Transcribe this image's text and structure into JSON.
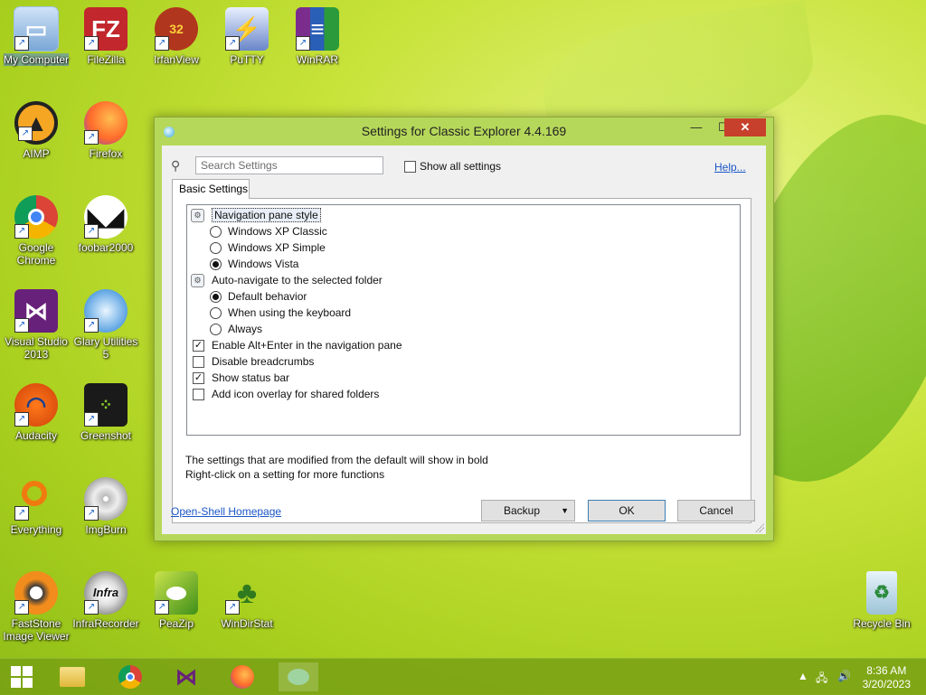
{
  "desktop": {
    "icons": [
      {
        "label": "My Computer"
      },
      {
        "label": "FileZilla"
      },
      {
        "label": "IrfanView"
      },
      {
        "label": "PuTTY"
      },
      {
        "label": "WinRAR"
      },
      {
        "label": "AIMP"
      },
      {
        "label": "Firefox"
      },
      {
        "label": "Google Chrome"
      },
      {
        "label": "foobar2000"
      },
      {
        "label": "Visual Studio 2013"
      },
      {
        "label": "Glary Utilities 5"
      },
      {
        "label": "Audacity"
      },
      {
        "label": "Greenshot"
      },
      {
        "label": "Everything"
      },
      {
        "label": "ImgBurn"
      },
      {
        "label": "FastStone Image Viewer"
      },
      {
        "label": "InfraRecorder"
      },
      {
        "label": "PeaZip"
      },
      {
        "label": "WinDirStat"
      },
      {
        "label": "Recycle Bin"
      }
    ]
  },
  "dialog": {
    "title": "Settings for Classic Explorer 4.4.169",
    "search_placeholder": "Search Settings",
    "show_all_label": "Show all settings",
    "help_label": "Help...",
    "tab_label": "Basic Settings",
    "settings": [
      {
        "label": "Navigation pane style"
      },
      {
        "label": "Windows XP Classic"
      },
      {
        "label": "Windows XP Simple"
      },
      {
        "label": "Windows Vista"
      },
      {
        "label": "Auto-navigate to the selected folder"
      },
      {
        "label": "Default behavior"
      },
      {
        "label": "When using the keyboard"
      },
      {
        "label": "Always"
      },
      {
        "label": "Enable Alt+Enter in the navigation pane"
      },
      {
        "label": "Disable breadcrumbs"
      },
      {
        "label": "Show status bar"
      },
      {
        "label": "Add icon overlay for shared folders"
      }
    ],
    "info_line1": "The settings that are modified from the default will show in bold",
    "info_line2": "Right-click on a setting for more functions",
    "homepage_label": "Open-Shell Homepage",
    "backup_label": "Backup",
    "ok_label": "OK",
    "cancel_label": "Cancel"
  },
  "taskbar": {
    "time": "8:36 AM",
    "date": "3/20/2023"
  },
  "colors": {
    "close_button": "#c7402b",
    "link": "#1a56c7",
    "frame": "#b6d85a"
  }
}
